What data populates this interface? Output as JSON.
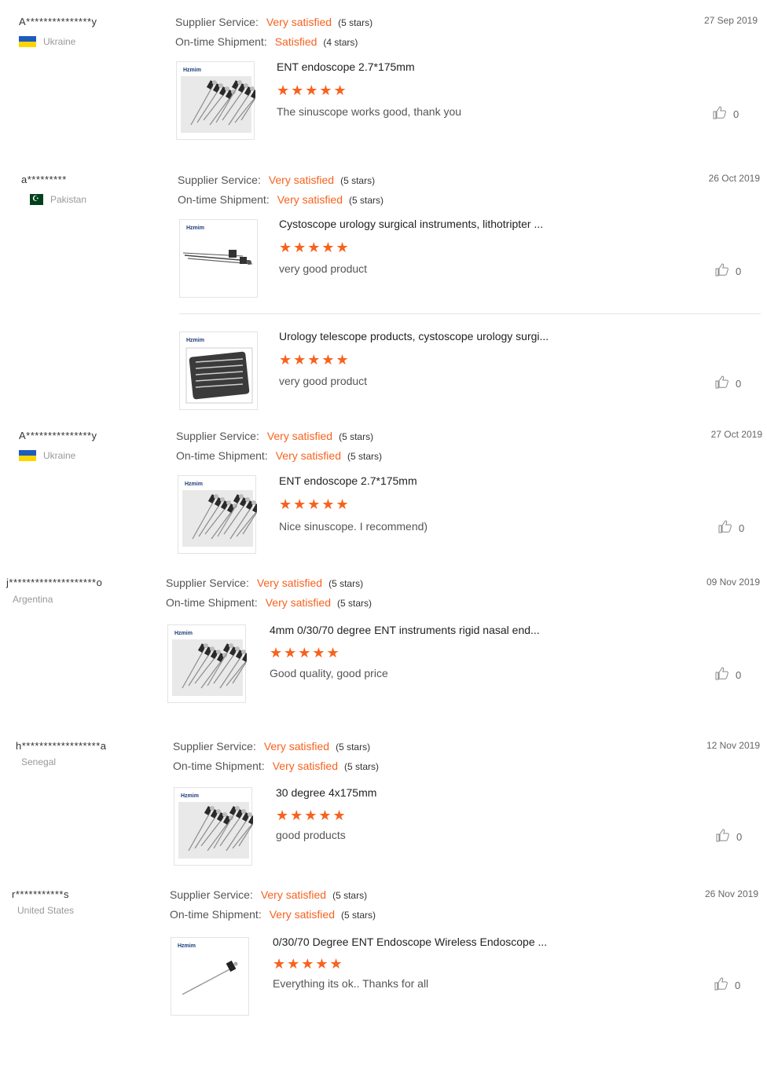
{
  "labels": {
    "supplier_service": "Supplier Service:",
    "ontime_shipment": "On-time Shipment:"
  },
  "reviews": [
    {
      "user": "A***************y",
      "country": "Ukraine",
      "flag": "ua",
      "date": "27 Sep 2019",
      "supplier_value": "Very satisfied",
      "supplier_stars": "(5 stars)",
      "shipment_value": "Satisfied",
      "shipment_stars": "(4 stars)",
      "items": [
        {
          "brand": "Hzmim",
          "title": "ENT endoscope 2.7*175mm",
          "stars": "★★★★★",
          "comment": "The sinuscope works good, thank you",
          "likes": "0",
          "image": "endoscope-bundle"
        }
      ]
    },
    {
      "user": "a*********",
      "country": "Pakistan",
      "flag": "pk",
      "date": "26 Oct 2019",
      "supplier_value": "Very satisfied",
      "supplier_stars": "(5 stars)",
      "shipment_value": "Very satisfied",
      "shipment_stars": "(5 stars)",
      "items": [
        {
          "brand": "Hzmim",
          "title": "Cystoscope urology surgical instruments, lithotripter ...",
          "stars": "★★★★★",
          "comment": "very good product",
          "likes": "0",
          "image": "cystoscope-set"
        },
        {
          "brand": "Hzmim",
          "title": "Urology telescope products, cystoscope urology surgi...",
          "stars": "★★★★★",
          "comment": "very good product",
          "likes": "0",
          "image": "instrument-case"
        }
      ]
    },
    {
      "user": "A***************y",
      "country": "Ukraine",
      "flag": "ua",
      "date": "27 Oct 2019",
      "supplier_value": "Very satisfied",
      "supplier_stars": "(5 stars)",
      "shipment_value": "Very satisfied",
      "shipment_stars": "(5 stars)",
      "items": [
        {
          "brand": "Hzmim",
          "title": "ENT endoscope 2.7*175mm",
          "stars": "★★★★★",
          "comment": "Nice sinuscope. I recommend)",
          "likes": "0",
          "image": "endoscope-bundle"
        }
      ]
    },
    {
      "user": "j********************o",
      "country": "Argentina",
      "flag": "",
      "date": "09 Nov 2019",
      "supplier_value": "Very satisfied",
      "supplier_stars": "(5 stars)",
      "shipment_value": "Very satisfied",
      "shipment_stars": "(5 stars)",
      "items": [
        {
          "brand": "Hzmim",
          "title": "4mm 0/30/70 degree ENT instruments rigid nasal end...",
          "stars": "★★★★★",
          "comment": "Good quality, good price",
          "likes": "0",
          "image": "endoscope-bundle"
        }
      ]
    },
    {
      "user": "h******************a",
      "country": "Senegal",
      "flag": "",
      "date": "12 Nov 2019",
      "supplier_value": "Very satisfied",
      "supplier_stars": "(5 stars)",
      "shipment_value": "Very satisfied",
      "shipment_stars": "(5 stars)",
      "items": [
        {
          "brand": "Hzmim",
          "title": "30 degree 4x175mm",
          "stars": "★★★★★",
          "comment": "good products",
          "likes": "0",
          "image": "endoscope-bundle"
        }
      ]
    },
    {
      "user": "r***********s",
      "country": "United States",
      "flag": "",
      "date": "26 Nov 2019",
      "supplier_value": "Very satisfied",
      "supplier_stars": "(5 stars)",
      "shipment_value": "Very satisfied",
      "shipment_stars": "(5 stars)",
      "items": [
        {
          "brand": "Hzmim",
          "title": "0/30/70 Degree ENT Endoscope Wireless Endoscope ...",
          "stars": "★★★★★",
          "comment": "Everything its ok.. Thanks for all",
          "likes": "0",
          "image": "single-endoscope"
        }
      ]
    }
  ],
  "colors": {
    "accent": "#f7621e",
    "muted": "#999999",
    "border": "#e3e3e3"
  }
}
